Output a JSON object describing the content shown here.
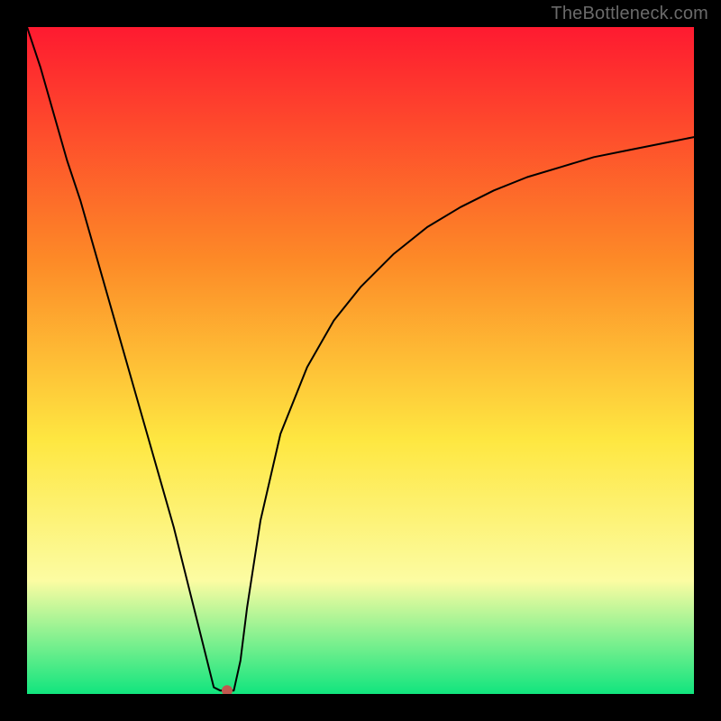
{
  "watermark": "TheBottleneck.com",
  "colors": {
    "top": "#fe1a30",
    "mid_upper": "#fd8a27",
    "mid": "#fee741",
    "mid_lower": "#fcfca2",
    "bottom": "#11e57e",
    "curve": "#000000",
    "marker": "#c1584f",
    "frame": "#000000"
  },
  "chart_data": {
    "type": "line",
    "title": "",
    "xlabel": "",
    "ylabel": "",
    "xlim": [
      0,
      100
    ],
    "ylim": [
      0,
      100
    ],
    "x": [
      0,
      2,
      4,
      6,
      8,
      10,
      12,
      14,
      16,
      18,
      20,
      22,
      24,
      26,
      27,
      28,
      29,
      30,
      31,
      32,
      33,
      35,
      38,
      42,
      46,
      50,
      55,
      60,
      65,
      70,
      75,
      80,
      85,
      90,
      95,
      100
    ],
    "values": [
      100,
      94,
      87,
      80,
      74,
      67,
      60,
      53,
      46,
      39,
      32,
      25,
      17,
      9,
      5,
      1,
      0.5,
      0.5,
      0.5,
      5,
      13,
      26,
      39,
      49,
      56,
      61,
      66,
      70,
      73,
      75.5,
      77.5,
      79,
      80.5,
      81.5,
      82.5,
      83.5
    ],
    "marker": {
      "x": 30,
      "y": 0.5
    },
    "annotations": []
  }
}
